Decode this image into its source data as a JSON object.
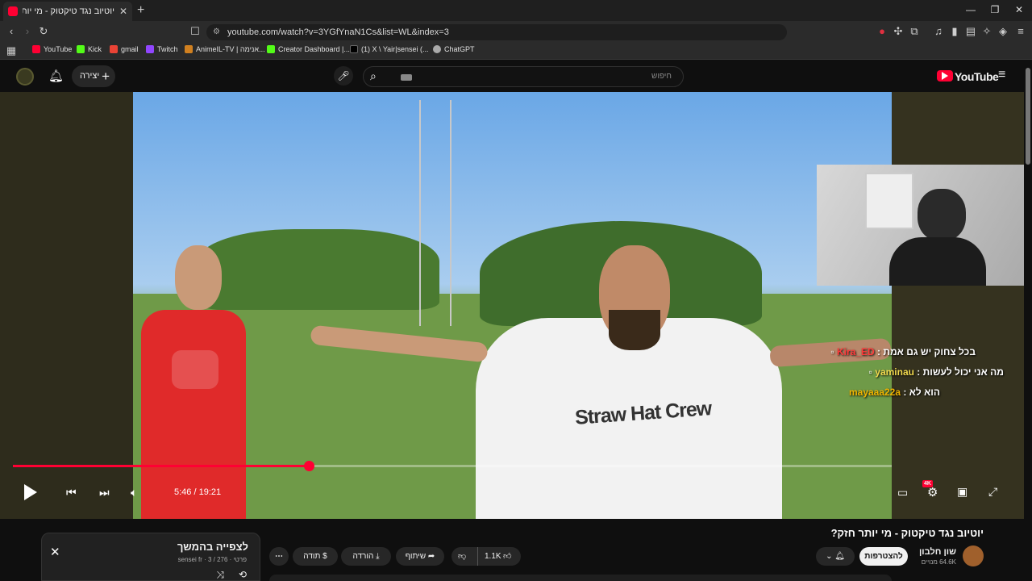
{
  "browser": {
    "tab_title": "יוטיוב נגד טיקטוק - מי יותר חזק?",
    "url": "youtube.com/watch?v=3YGfYnaN1Cs&list=WL&index=3",
    "bookmarks": [
      "YouTube",
      "Kick",
      "gmail",
      "Twitch",
      "AnimeIL-TV | אנימה...",
      "Creator Dashboard |...",
      "(1) X \\ Yair|sensei (...",
      "ChatGPT"
    ]
  },
  "youtube": {
    "logo_text": "YouTube",
    "create_label": "יצירה",
    "search_placeholder": "חיפוש"
  },
  "chat": [
    {
      "user": "Kira_ED",
      "message": "בכל צחוק יש גם אמת",
      "user_color": "#ff3b3b"
    },
    {
      "user": "yaminau",
      "message": "מה אני יכול לעשות",
      "user_color": "#f2d94e"
    },
    {
      "user": "mayaaa22a",
      "message": "הוא לא",
      "user_color": "#f0b400"
    }
  ],
  "player": {
    "time": "5:46 / 19:21",
    "progress_fraction": 0.337,
    "quality_badge": "4K",
    "shirt_text": "Straw Hat Crew"
  },
  "video": {
    "title": "יוטיוב נגד טיקטוק - מי יותר חזק?",
    "channel": "שון חלבון",
    "subscribers": "64.6K מנויים",
    "subscribe_label": "להצטרפות",
    "likes": "1.1K",
    "share_label": "שיתוף",
    "download_label": "הורדה",
    "thanks_label": "תודה"
  },
  "playlist": {
    "title": "לצפייה בהמשך",
    "meta": "פרטי · sensei fr · 3 / 276"
  },
  "colors": {
    "accent": "#ff0033"
  }
}
